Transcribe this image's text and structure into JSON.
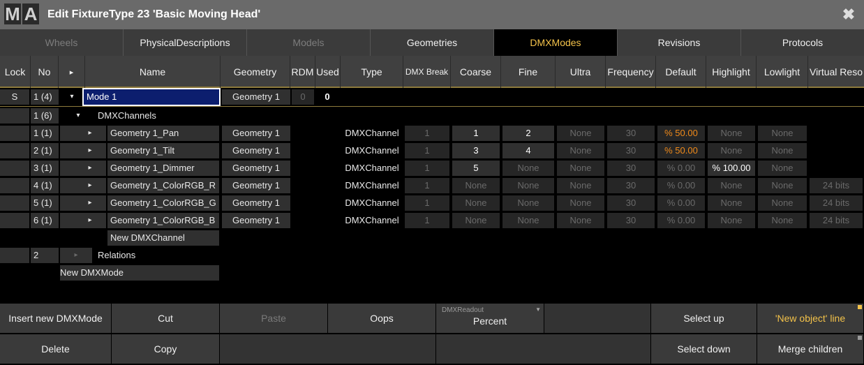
{
  "window": {
    "logo": [
      "M",
      "A"
    ],
    "title": "Edit FixtureType 23 'Basic Moving Head'",
    "close_icon": "close-x-icon"
  },
  "tabs": [
    {
      "label": "Wheels",
      "state": "disabled"
    },
    {
      "label": "PhysicalDescriptions",
      "state": "normal"
    },
    {
      "label": "Models",
      "state": "disabled"
    },
    {
      "label": "Geometries",
      "state": "normal"
    },
    {
      "label": "DMXModes",
      "state": "active"
    },
    {
      "label": "Revisions",
      "state": "normal"
    },
    {
      "label": "Protocols",
      "state": "normal"
    }
  ],
  "columns": {
    "lock": "Lock",
    "no": "No",
    "expand": "▸",
    "name": "Name",
    "geometry": "Geometry",
    "rdm": "RDM",
    "used": "Used",
    "type": "Type",
    "dmx_break": "DMX Break",
    "coarse": "Coarse",
    "fine": "Fine",
    "ultra": "Ultra",
    "frequency": "Frequency",
    "default": "Default",
    "highlight": "Highlight",
    "lowlight": "Lowlight",
    "virtual_reso": "Virtual Reso"
  },
  "mode_row": {
    "lock": "S",
    "no": "1 (4)",
    "expand": "▾",
    "name": "Mode 1",
    "geometry": "Geometry 1",
    "rdm": "0",
    "used": "0"
  },
  "channels_group": {
    "no": "1 (6)",
    "expand": "▾",
    "name": "DMXChannels"
  },
  "channels": [
    {
      "no": "1 (1)",
      "name": "Geometry 1_Pan",
      "geometry": "Geometry 1",
      "type": "DMXChannel",
      "dmx_break": "1",
      "coarse": "1",
      "fine": "2",
      "ultra": "None",
      "frequency": "30",
      "default": "% 50.00",
      "highlight": "None",
      "lowlight": "None",
      "virtual": ""
    },
    {
      "no": "2 (1)",
      "name": "Geometry 1_Tilt",
      "geometry": "Geometry 1",
      "type": "DMXChannel",
      "dmx_break": "1",
      "coarse": "3",
      "fine": "4",
      "ultra": "None",
      "frequency": "30",
      "default": "% 50.00",
      "highlight": "None",
      "lowlight": "None",
      "virtual": ""
    },
    {
      "no": "3 (1)",
      "name": "Geometry 1_Dimmer",
      "geometry": "Geometry 1",
      "type": "DMXChannel",
      "dmx_break": "1",
      "coarse": "5",
      "fine": "None",
      "ultra": "None",
      "frequency": "30",
      "default": "% 0.00",
      "highlight": "% 100.00",
      "lowlight": "None",
      "virtual": ""
    },
    {
      "no": "4 (1)",
      "name": "Geometry 1_ColorRGB_R",
      "geometry": "Geometry 1",
      "type": "DMXChannel",
      "dmx_break": "1",
      "coarse": "None",
      "fine": "None",
      "ultra": "None",
      "frequency": "30",
      "default": "% 0.00",
      "highlight": "None",
      "lowlight": "None",
      "virtual": "24 bits"
    },
    {
      "no": "5 (1)",
      "name": "Geometry 1_ColorRGB_G",
      "geometry": "Geometry 1",
      "type": "DMXChannel",
      "dmx_break": "1",
      "coarse": "None",
      "fine": "None",
      "ultra": "None",
      "frequency": "30",
      "default": "% 0.00",
      "highlight": "None",
      "lowlight": "None",
      "virtual": "24 bits"
    },
    {
      "no": "6 (1)",
      "name": "Geometry 1_ColorRGB_B",
      "geometry": "Geometry 1",
      "type": "DMXChannel",
      "dmx_break": "1",
      "coarse": "None",
      "fine": "None",
      "ultra": "None",
      "frequency": "30",
      "default": "% 0.00",
      "highlight": "None",
      "lowlight": "None",
      "virtual": "24 bits"
    }
  ],
  "channel_expand": "▸",
  "new_channel": "New DMXChannel",
  "relations": {
    "no": "2",
    "expand": "▸",
    "name": "Relations"
  },
  "new_mode": "New DMXMode",
  "buttons": {
    "insert": "Insert new DMXMode",
    "cut": "Cut",
    "paste": "Paste",
    "oops": "Oops",
    "readout_label": "DMXReadout",
    "readout_value": "Percent",
    "select_up": "Select up",
    "new_object_line": "'New object' line",
    "delete": "Delete",
    "copy": "Copy",
    "select_down": "Select down",
    "merge_children": "Merge children"
  },
  "colors": {
    "accent": "#f3c24a",
    "orange": "#f08a1a",
    "selection": "#0c1e6e"
  }
}
